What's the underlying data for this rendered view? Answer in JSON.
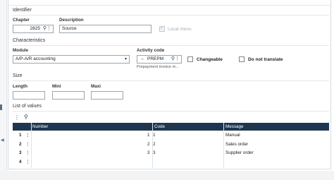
{
  "identifier": {
    "section_title": "Identifier",
    "chapter_label": "Chapter",
    "chapter_value": "2825",
    "description_label": "Description",
    "description_value": "Source",
    "local_menu_label": "Local menu"
  },
  "characteristics": {
    "section_title": "Characteristics",
    "module_label": "Module",
    "module_value": "A/P-A/R accounting",
    "activity_code_label": "Activity code",
    "activity_code_value": "PREPM",
    "activity_code_hint": "Prepayment invoice m...",
    "changeable_label": "Changeable",
    "do_not_translate_label": "Do not translate"
  },
  "size": {
    "section_title": "Size",
    "length_label": "Length",
    "mini_label": "Mini",
    "maxi_label": "Maxi"
  },
  "list_of_values": {
    "section_title": "List of values",
    "columns": [
      "Number",
      "Code",
      "Message"
    ],
    "rows": [
      {
        "index": "1",
        "number": "1",
        "code": "1",
        "message": "Manual"
      },
      {
        "index": "2",
        "number": "2",
        "code": "2",
        "message": "Sales order"
      },
      {
        "index": "3",
        "number": "3",
        "code": "3",
        "message": "Supplier order"
      },
      {
        "index": "4",
        "number": "",
        "code": "",
        "message": ""
      }
    ]
  },
  "colors": {
    "grid_header": "#1e3650",
    "icon": "#1d3b5c"
  },
  "icons": {
    "search": "search-icon",
    "more": "vertical-dots-icon",
    "arrow": "arrow-right-icon",
    "dropdown": "chevron-down-icon"
  }
}
